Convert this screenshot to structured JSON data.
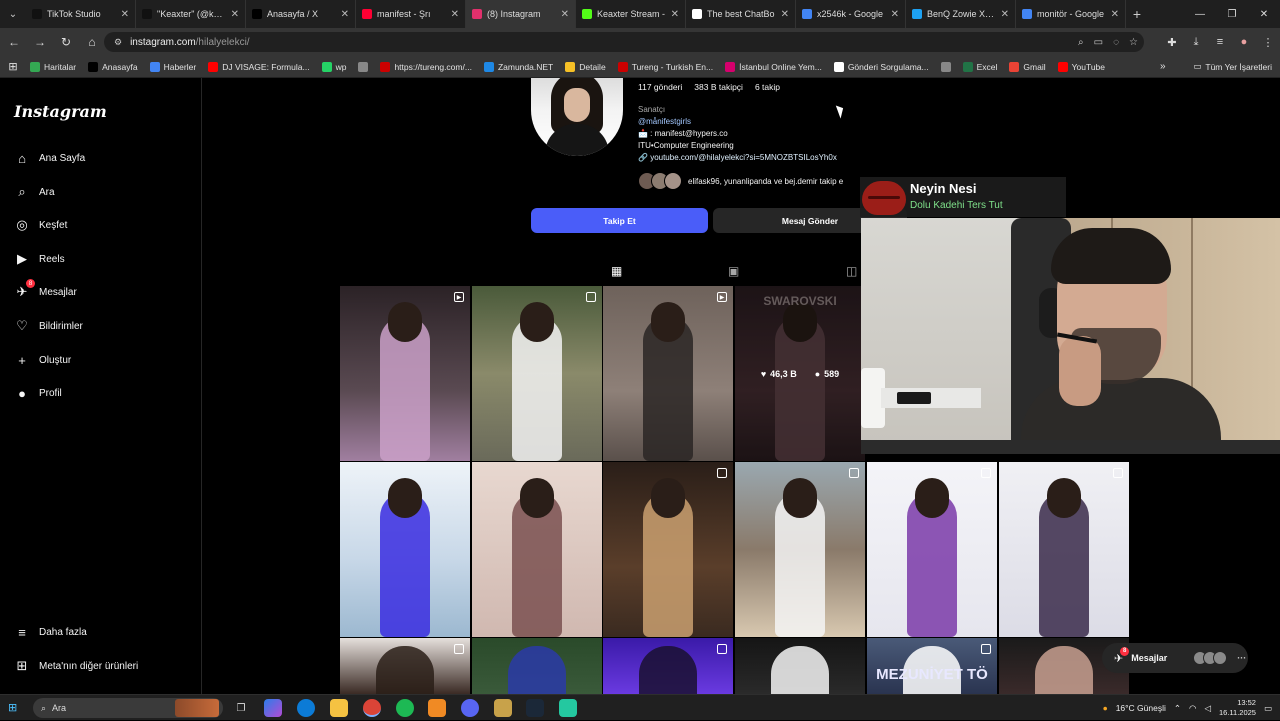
{
  "browser": {
    "tabs": [
      {
        "title": "TikTok Studio",
        "color": "#111111"
      },
      {
        "title": "\"Keaxter\" (@keax",
        "color": "#111111"
      },
      {
        "title": "Anasayfa / X",
        "color": "#000000"
      },
      {
        "title": "manifest - Şrı",
        "color": "#ff0033"
      },
      {
        "title": "(8) Instagram",
        "color": "#e1306c"
      },
      {
        "title": "Keaxter Stream -",
        "color": "#53fc18"
      },
      {
        "title": "The best ChatBo",
        "color": "#ffffff"
      },
      {
        "title": "x2546k - Google",
        "color": "#4285f4"
      },
      {
        "title": "BenQ Zowie XL25",
        "color": "#1da1f2"
      },
      {
        "title": "monitör - Google",
        "color": "#4285f4"
      }
    ],
    "active_tab_index": 4,
    "url_host": "instagram.com",
    "url_path": "/hilalyelekci/",
    "bookmarks": [
      {
        "label": "Haritalar",
        "color": "#34a853"
      },
      {
        "label": "Anasayfa",
        "color": "#000000"
      },
      {
        "label": "Haberler",
        "color": "#4285f4"
      },
      {
        "label": "DJ VISAGE: Formula...",
        "color": "#ff0000"
      },
      {
        "label": "wp",
        "color": "#25d366"
      },
      {
        "label": "",
        "color": "#888888"
      },
      {
        "label": "https://tureng.com/...",
        "color": "#cc0000"
      },
      {
        "label": "Zamunda.NET",
        "color": "#1e88e5"
      },
      {
        "label": "Detaile",
        "color": "#f6c026"
      },
      {
        "label": "Tureng - Turkish En...",
        "color": "#cc0000"
      },
      {
        "label": "İstanbul Online Yem...",
        "color": "#d6006d"
      },
      {
        "label": "Gönderi Sorgulama...",
        "color": "#ffffff"
      },
      {
        "label": "",
        "color": "#888888"
      },
      {
        "label": "Excel",
        "color": "#217346"
      },
      {
        "label": "Gmail",
        "color": "#ea4335"
      },
      {
        "label": "YouTube",
        "color": "#ff0000"
      }
    ],
    "all_bookmarks": "Tüm Yer İşaretleri"
  },
  "sidebar": {
    "logo": "Instagram",
    "items": [
      {
        "label": "Ana Sayfa",
        "icon": "⌂"
      },
      {
        "label": "Ara",
        "icon": "⌕"
      },
      {
        "label": "Keşfet",
        "icon": "◎"
      },
      {
        "label": "Reels",
        "icon": "▶"
      },
      {
        "label": "Mesajlar",
        "icon": "✈"
      },
      {
        "label": "Bildirimler",
        "icon": "♡"
      },
      {
        "label": "Oluştur",
        "icon": "+"
      },
      {
        "label": "Profil",
        "icon": "●"
      }
    ],
    "messages_badge": "8",
    "more": "Daha fazla",
    "meta": "Meta'nın diğer ürünleri"
  },
  "profile": {
    "posts": "117 gönderi",
    "followers": "383 B takipçi",
    "following": "6 takip",
    "category": "Sanatçı",
    "tag": "@månifestgirls",
    "contact": "📩 : manifest@hypers.co",
    "school": "ITU•Computer Engineering",
    "link": "youtube.com/@hilalyelekci?si=5MNOZBTSILosYh0x",
    "followed_by": "elifask96, yunanlipanda ve bej.demir takip e",
    "follow_button": "Takip Et",
    "message_button": "Mesaj Gönder"
  },
  "grid": {
    "hover_likes": "46,3 B",
    "hover_comments": "589",
    "tile_text_1": "SWAROVSKI",
    "tile_text_2": "MEZUNİYET TÖ"
  },
  "overlay": {
    "song_title": "Neyin Nesi",
    "song_artist": "Dolu Kadehi Ters Tut"
  },
  "messages_pill": {
    "label": "Mesajlar",
    "badge": "8"
  },
  "taskbar": {
    "search": "Ara",
    "weather": "16°C  Güneşli",
    "time": "13:52",
    "date": "16.11.2025"
  }
}
